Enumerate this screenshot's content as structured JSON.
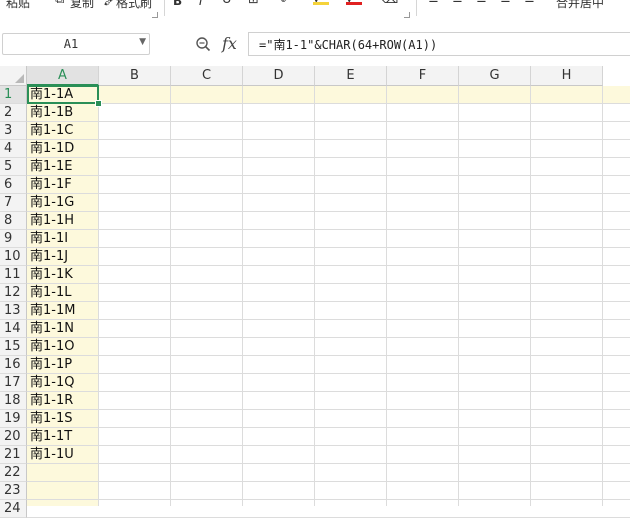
{
  "ribbon": {
    "paste_label": "粘贴",
    "copy_label": "复制",
    "format_painter_label": "格式刷",
    "bold": "B",
    "italic": "I",
    "merge_label": "合并居中"
  },
  "formula_bar": {
    "name_box": "A1",
    "fx_label": "fx",
    "formula": "=\"南1-1\"&CHAR(64+ROW(A1))"
  },
  "grid": {
    "columns": [
      "A",
      "B",
      "C",
      "D",
      "E",
      "F",
      "G",
      "H"
    ],
    "active_column": "A",
    "active_row": 1,
    "rows": [
      {
        "num": "1",
        "a": "南1-1A"
      },
      {
        "num": "2",
        "a": "南1-1B"
      },
      {
        "num": "3",
        "a": "南1-1C"
      },
      {
        "num": "4",
        "a": "南1-1D"
      },
      {
        "num": "5",
        "a": "南1-1E"
      },
      {
        "num": "6",
        "a": "南1-1F"
      },
      {
        "num": "7",
        "a": "南1-1G"
      },
      {
        "num": "8",
        "a": "南1-1H"
      },
      {
        "num": "9",
        "a": "南1-1I"
      },
      {
        "num": "10",
        "a": "南1-1J"
      },
      {
        "num": "11",
        "a": "南1-1K"
      },
      {
        "num": "12",
        "a": "南1-1L"
      },
      {
        "num": "13",
        "a": "南1-1M"
      },
      {
        "num": "14",
        "a": "南1-1N"
      },
      {
        "num": "15",
        "a": "南1-1O"
      },
      {
        "num": "16",
        "a": "南1-1P"
      },
      {
        "num": "17",
        "a": "南1-1Q"
      },
      {
        "num": "18",
        "a": "南1-1R"
      },
      {
        "num": "19",
        "a": "南1-1S"
      },
      {
        "num": "20",
        "a": "南1-1T"
      },
      {
        "num": "21",
        "a": "南1-1U"
      },
      {
        "num": "22",
        "a": ""
      },
      {
        "num": "23",
        "a": ""
      },
      {
        "num": "24",
        "a": ""
      }
    ]
  },
  "colors": {
    "accent": "#2a8f57",
    "highlight": "#fdf9dc",
    "font_color_bar": "#e02020",
    "fill_color_bar": "#f5d33a"
  }
}
